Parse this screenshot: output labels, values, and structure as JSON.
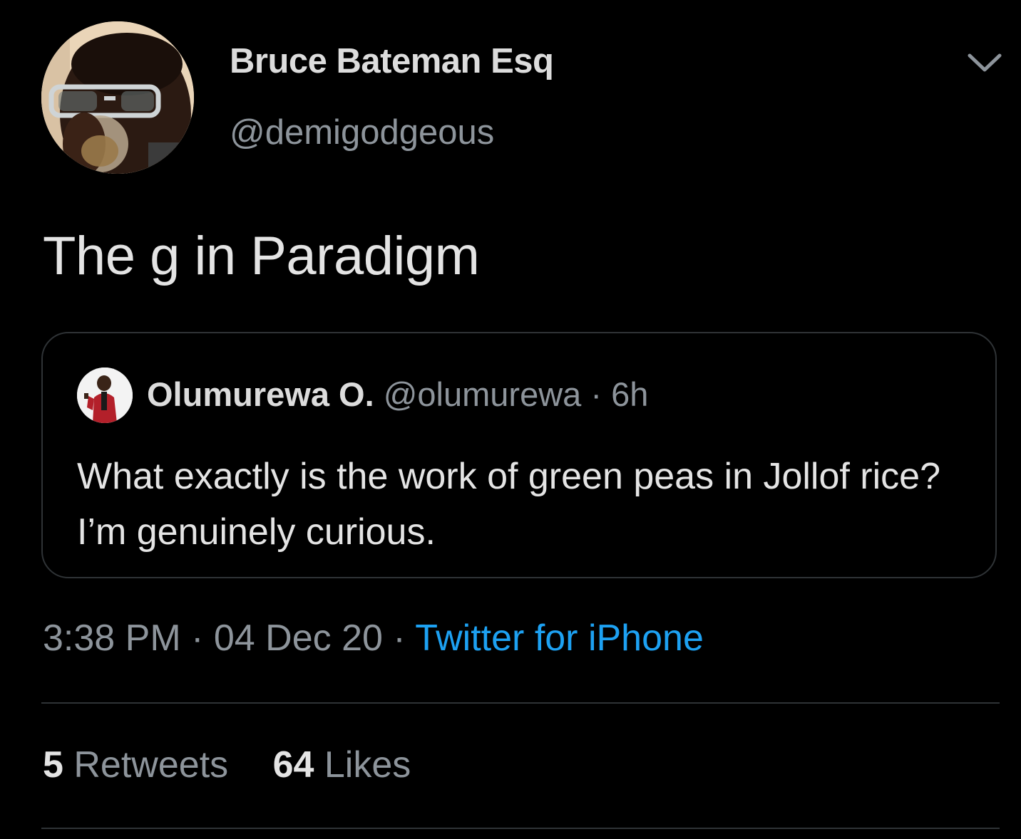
{
  "author": {
    "display_name": "Bruce Bateman Esq",
    "handle": "@demigodgeous",
    "avatar_icon": "profile-photo-man-glasses-drinking"
  },
  "menu": {
    "icon": "chevron-down-icon"
  },
  "tweet": {
    "text": "The g in Paradigm"
  },
  "quoted_tweet": {
    "display_name": "Olumurewa O.",
    "handle": "@olumurewa",
    "separator": "·",
    "time": "6h",
    "text": "What exactly is the work of green peas in Jollof rice? I’m genuinely curious.",
    "avatar_icon": "profile-photo-man-red-suit"
  },
  "meta": {
    "time": "3:38 PM",
    "separator": "·",
    "date": "04 Dec 20",
    "source": "Twitter for iPhone"
  },
  "stats": {
    "retweets_count": "5",
    "retweets_label": "Retweets",
    "likes_count": "64",
    "likes_label": "Likes"
  },
  "colors": {
    "background": "#000000",
    "primary_text": "#e4e4e4",
    "secondary_text": "#8d949b",
    "accent": "#1da1f2",
    "border": "#2f3336"
  }
}
